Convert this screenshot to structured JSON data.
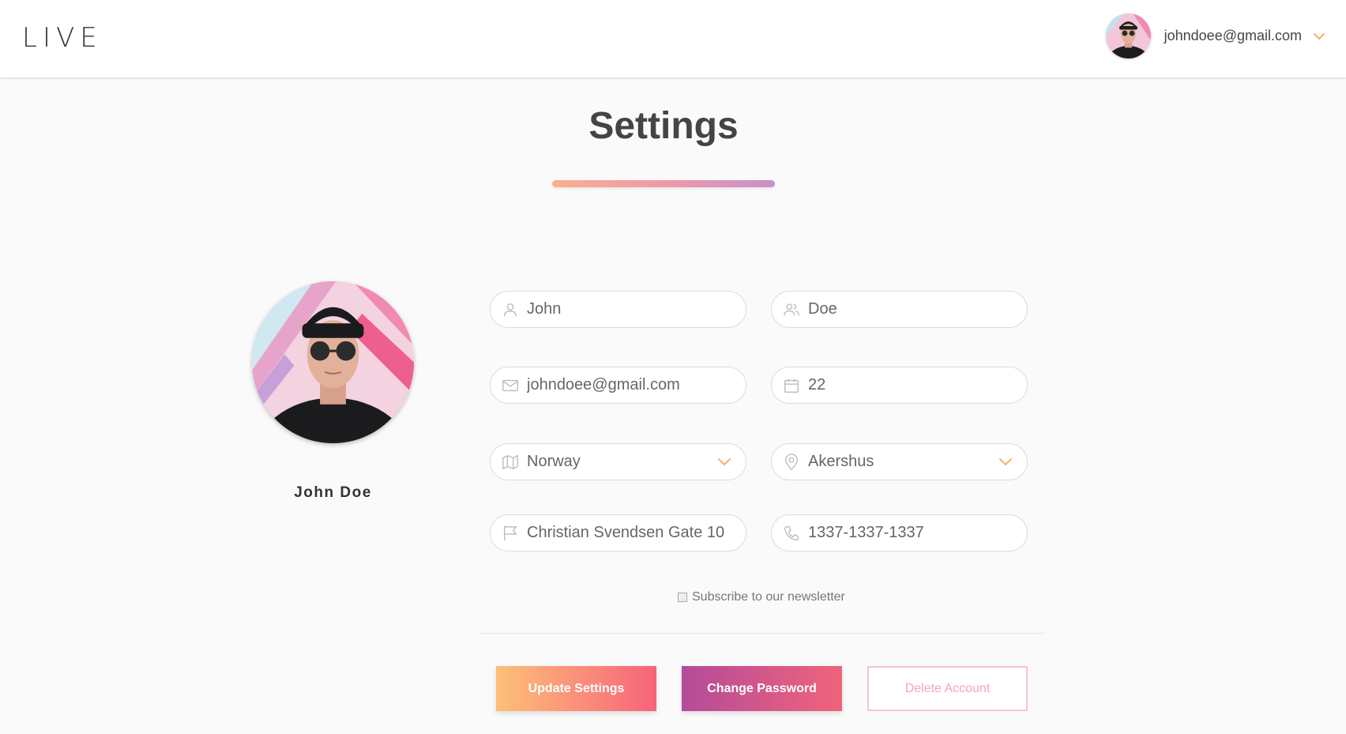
{
  "header": {
    "logo": "LIVE",
    "user_email": "johndoee@gmail.com"
  },
  "page": {
    "title": "Settings"
  },
  "profile": {
    "name": "John Doe"
  },
  "form": {
    "first_name": "John",
    "last_name": "Doe",
    "email": "johndoee@gmail.com",
    "age": "22",
    "country": "Norway",
    "region": "Akershus",
    "address": "Christian Svendsen Gate 10",
    "phone": "1337-1337-1337",
    "newsletter_label": "Subscribe to our newsletter"
  },
  "buttons": {
    "update": "Update Settings",
    "change_password": "Change Password",
    "delete": "Delete Account"
  },
  "colors": {
    "accent_orange": "#fdbf78",
    "accent_pink": "#f7637a",
    "accent_purple": "#b44b9a",
    "chevron": "#f5b16b"
  },
  "icons": {
    "first_name": "user-icon",
    "last_name": "users-icon",
    "email": "mail-icon",
    "age": "calendar-icon",
    "country": "map-icon",
    "region": "location-pin-icon",
    "address": "flag-icon",
    "phone": "phone-icon",
    "dropdown": "chevron-down-icon"
  }
}
